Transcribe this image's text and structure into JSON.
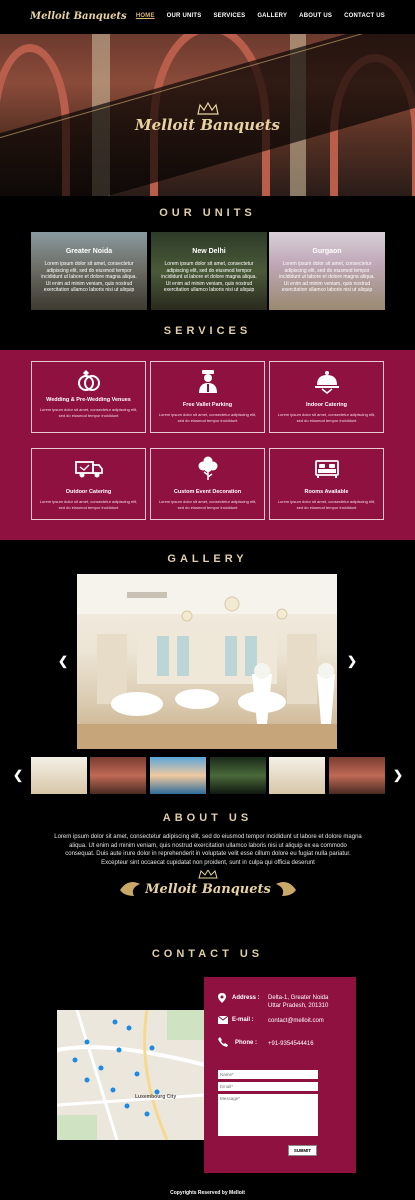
{
  "nav": {
    "logo": "Melloit Banquets",
    "links": [
      "HOME",
      "OUR UNITS",
      "SERVICES",
      "GALLERY",
      "ABOUT US",
      "CONTACT US"
    ],
    "active": "HOME"
  },
  "hero": {
    "title": "Melloit Banquets"
  },
  "units": {
    "title": "OUR UNITS",
    "items": [
      {
        "name": "Greater Noida",
        "desc": "Lorem ipsum dolor sit amet, consectetur adipiscing elit, sed do eiusmod tempor incididunt ut labore et dolore magna aliqua. Ut enim ad minim veniam, quis nostrud exercitation ullamco laboris nisi ut aliquip"
      },
      {
        "name": "New Delhi",
        "desc": "Lorem ipsum dolor sit amet, consectetur adipiscing elit, sed do eiusmod tempor incididunt ut labore et dolore magna aliqua. Ut enim ad minim veniam, quis nostrud exercitation ullamco laboris nisi ut aliquip"
      },
      {
        "name": "Gurgaon",
        "desc": "Lorem ipsum dolor sit amet, consectetur adipiscing elit, sed do eiusmod tempor incididunt ut labore et dolore magna aliqua. Ut enim ad minim veniam, quis nostrud exercitation ullamco laboris nisi ut aliquip"
      }
    ]
  },
  "services": {
    "title": "SERVICES",
    "items": [
      {
        "label": "Wedding & Pre-Wedding Venues",
        "icon": "rings-icon",
        "desc": "Lorem ipsum dolor sit amet, consectetur adipiscing elit, sed do eiusmod tempor incididunt"
      },
      {
        "label": "Free Vallet Parking",
        "icon": "valet-icon",
        "desc": "Lorem ipsum dolor sit amet, consectetur adipiscing elit, sed do eiusmod tempor incididunt"
      },
      {
        "label": "Indoor Catering",
        "icon": "cloche-icon",
        "desc": "Lorem ipsum dolor sit amet, consectetur adipiscing elit, sed do eiusmod tempor incididunt"
      },
      {
        "label": "Outdoor Catering",
        "icon": "truck-icon",
        "desc": "Lorem ipsum dolor sit amet, consectetur adipiscing elit, sed do eiusmod tempor incididunt"
      },
      {
        "label": "Custom Event Decoration",
        "icon": "flower-icon",
        "desc": "Lorem ipsum dolor sit amet, consectetur adipiscing elit, sed do eiusmod tempor incididunt"
      },
      {
        "label": "Rooms Available",
        "icon": "bed-icon",
        "desc": "Lorem ipsum dolor sit amet, consectetur adipiscing elit, sed do eiusmod tempor incididunt"
      }
    ]
  },
  "gallery": {
    "title": "GALLERY",
    "prev": "❮",
    "next": "❯",
    "thumb_prev": "❮",
    "thumb_next": "❯"
  },
  "about": {
    "title": "ABOUT US",
    "text": "Lorem ipsum dolor sit amet, consectetur adipiscing elit, sed do eiusmod tempor incididunt ut labore et dolore magna aliqua. Ut enim ad minim veniam, quis nostrud exercitation ullamco laboris nisi ut aliquip ex ea commodo consequat. Duis aute irure dolor in reprehenderit in voluptate velit esse cillum dolore eu fugiat nulla pariatur. Excepteur sint occaecat cupidatat non proident, sunt in culpa qui officia deserunt",
    "logo": "Melloit Banquets"
  },
  "contact": {
    "title": "CONTACT US",
    "address_label": "Address :",
    "address_line1": "Delta-1, Greater Noida",
    "address_line2": "Uttar Pradesh, 201310",
    "email_label": "E-mail :",
    "email": "contact@melloit.com",
    "phone_label": "Phone :",
    "phone": "+91-9354544416",
    "name_placeholder": "Name*",
    "email_placeholder": "Email*",
    "message_placeholder": "Message*",
    "submit": "SUBMIT",
    "map_city": "Luxembourg City"
  },
  "footer": {
    "text": "Copyrights Reserved by Melloit"
  },
  "colors": {
    "accent": "#8e1140",
    "gold": "#e0cfa8",
    "background": "#000000"
  }
}
